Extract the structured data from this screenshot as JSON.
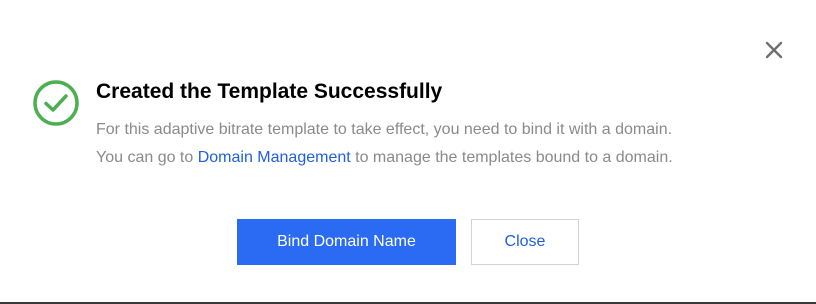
{
  "dialog": {
    "title": "Created the Template Successfully",
    "description_line1": "For this adaptive bitrate template to take effect, you need to bind it with a domain.",
    "description_line2_prefix": "You can go to ",
    "description_line2_link": "Domain Management",
    "description_line2_suffix": " to manage the templates bound to a domain.",
    "icons": {
      "status": "check-circle-icon",
      "close": "close-icon"
    },
    "colors": {
      "success": "#4caf50",
      "primary": "#2b6bf3",
      "link": "#1f5fe0",
      "muted_text": "#8a8a8a"
    }
  },
  "buttons": {
    "primary_label": "Bind Domain Name",
    "secondary_label": "Close"
  }
}
